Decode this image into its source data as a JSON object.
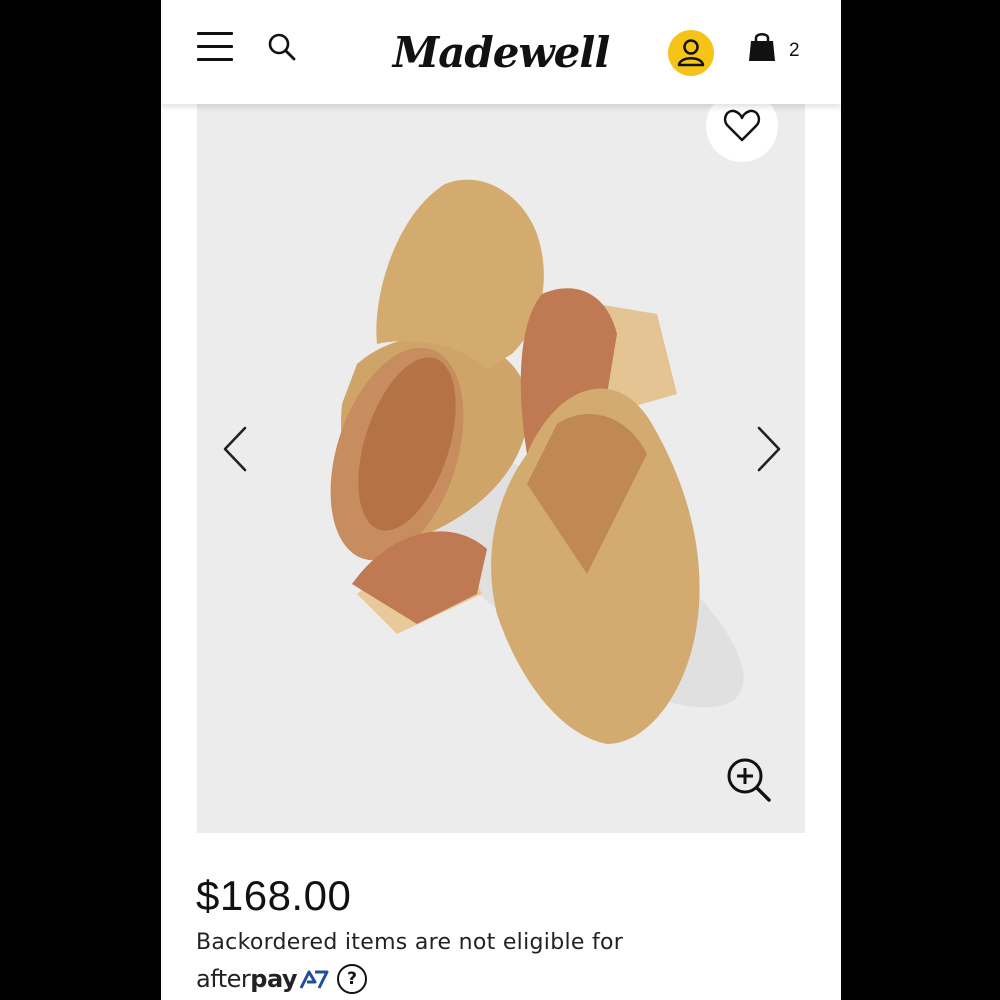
{
  "header": {
    "brand": "Madewell",
    "menu_icon": "hamburger-menu-icon",
    "search_icon": "search-icon",
    "account_icon": "user-icon",
    "bag_icon": "shopping-bag-icon",
    "bag_count": "2",
    "account_color": "#f6c317"
  },
  "gallery": {
    "favorite_icon": "heart-icon",
    "prev_icon": "chevron-left-icon",
    "next_icon": "chevron-right-icon",
    "zoom_icon": "zoom-in-icon",
    "background": "#ececec"
  },
  "product": {
    "price": "$168.00",
    "afterpay_notice": "Backordered items are not eligible for",
    "afterpay_brand_light": "after",
    "afterpay_brand_bold": "pay",
    "help_label": "?"
  }
}
